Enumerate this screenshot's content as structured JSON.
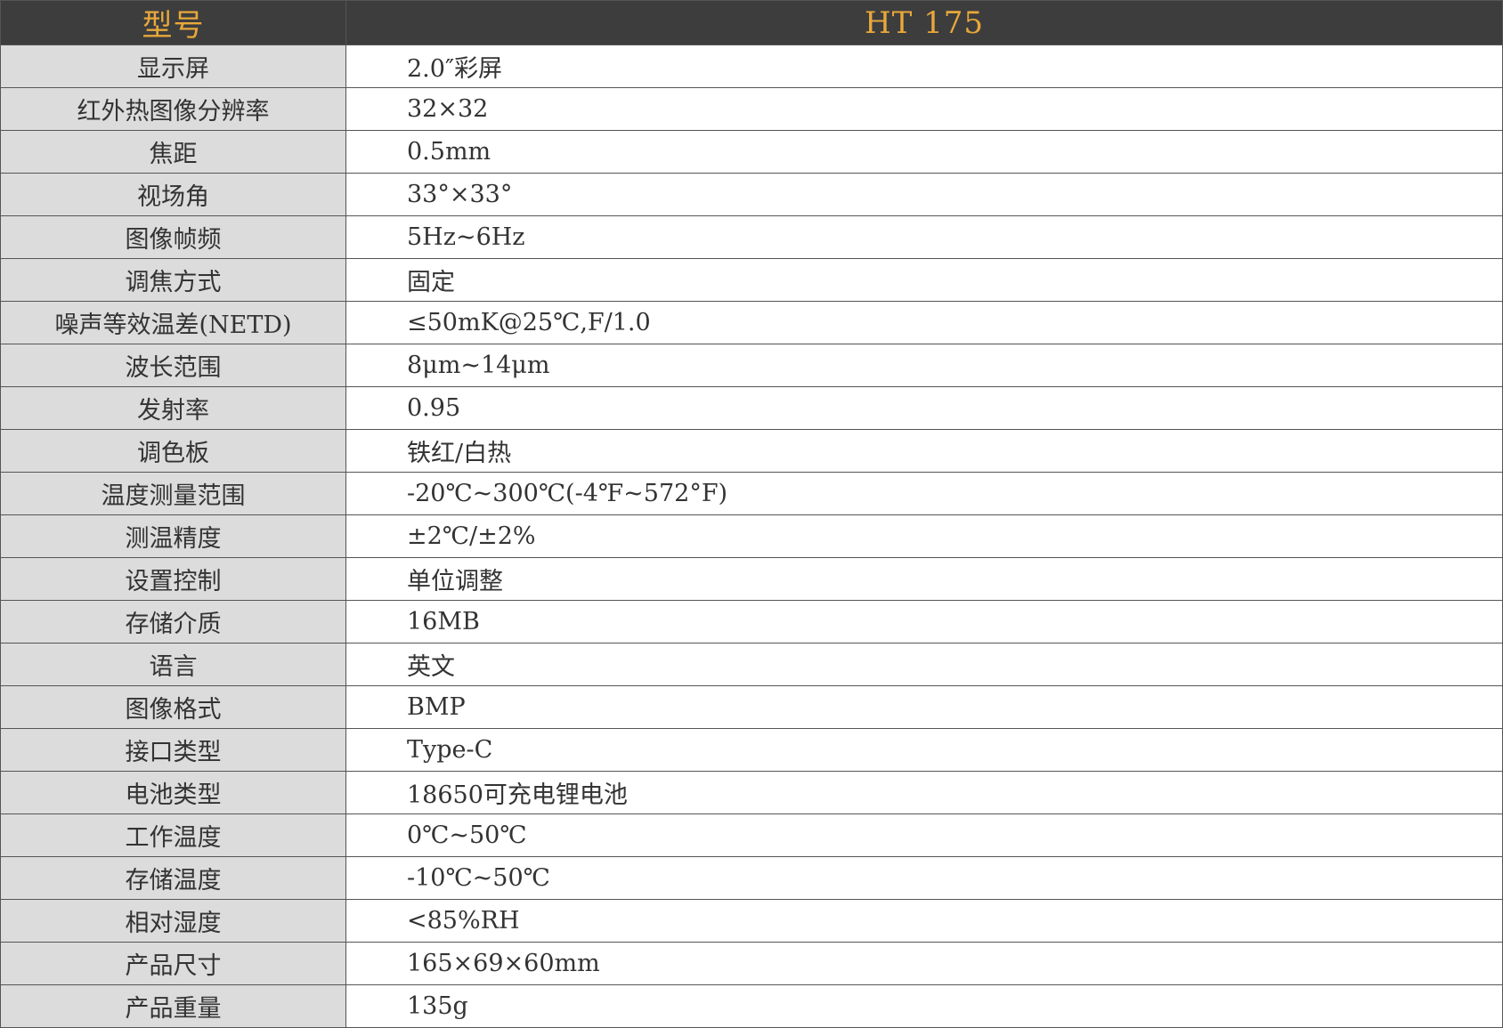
{
  "header": {
    "label": "型号",
    "model": "HT 175"
  },
  "specs": [
    {
      "param": "显示屏",
      "value": "2.0″彩屏"
    },
    {
      "param": "红外热图像分辨率",
      "value": "32×32"
    },
    {
      "param": "焦距",
      "value": "0.5mm"
    },
    {
      "param": "视场角",
      "value": "33°×33°"
    },
    {
      "param": "图像帧频",
      "value": "5Hz~6Hz"
    },
    {
      "param": "调焦方式",
      "value": "固定"
    },
    {
      "param": "噪声等效温差(NETD)",
      "value": "≤50mK@25℃,F/1.0"
    },
    {
      "param": "波长范围",
      "value": "8μm~14μm"
    },
    {
      "param": "发射率",
      "value": "0.95"
    },
    {
      "param": "调色板",
      "value": "铁红/白热"
    },
    {
      "param": "温度测量范围",
      "value": "-20℃~300℃(-4℉~572°F)"
    },
    {
      "param": "测温精度",
      "value": "±2℃/±2%"
    },
    {
      "param": "设置控制",
      "value": "单位调整"
    },
    {
      "param": "存储介质",
      "value": "16MB"
    },
    {
      "param": "语言",
      "value": "英文"
    },
    {
      "param": "图像格式",
      "value": "BMP"
    },
    {
      "param": "接口类型",
      "value": "Type-C"
    },
    {
      "param": "电池类型",
      "value": "18650可充电锂电池"
    },
    {
      "param": "工作温度",
      "value": "0℃~50℃"
    },
    {
      "param": "存储温度",
      "value": "-10℃~50℃"
    },
    {
      "param": "相对湿度",
      "value": "<85%RH"
    },
    {
      "param": "产品尺寸",
      "value": "165×69×60mm"
    },
    {
      "param": "产品重量",
      "value": "135g"
    }
  ]
}
